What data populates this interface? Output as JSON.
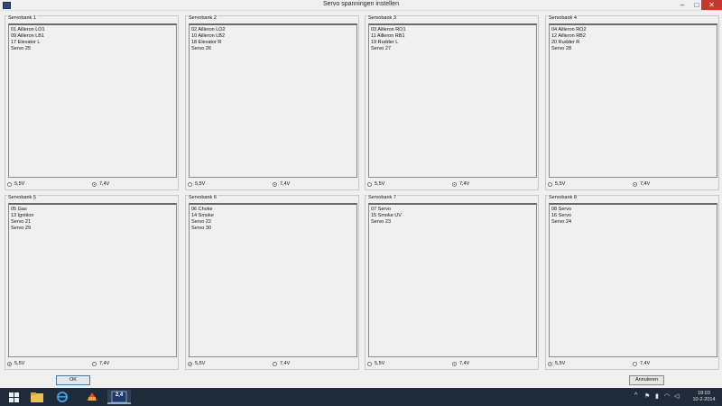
{
  "window": {
    "title": "Servo spanningen instellen",
    "minimize": "–",
    "maximize": "□",
    "close": "✕"
  },
  "banks": [
    {
      "caption": "Servobank 1",
      "items": [
        "01 Ailleron LO1",
        "09 Ailleron LB1",
        "17 Elevator L",
        "Servo 25"
      ],
      "low": "5,5V",
      "high": "7,4V",
      "selected": "7,4V"
    },
    {
      "caption": "Servobank 2",
      "items": [
        "02 Ailleron LO2",
        "10 Ailleron LB2",
        "18 Elevator R",
        "Servo 26"
      ],
      "low": "5,5V",
      "high": "7,4V",
      "selected": "7,4V"
    },
    {
      "caption": "Servobank 3",
      "items": [
        "03 Ailleron RO1",
        "11 Ailleron RB1",
        "19 Rudder L",
        "Servo 27"
      ],
      "low": "5,5V",
      "high": "7,4V",
      "selected": "7,4V"
    },
    {
      "caption": "Servobank 4",
      "items": [
        "04 Ailleron RO2",
        "12 Ailleron RB2",
        "20 Rudder R",
        "Servo 28"
      ],
      "low": "5,5V",
      "high": "7,4V",
      "selected": "7,4V"
    },
    {
      "caption": "Servobank 5",
      "items": [
        "05 Gas",
        "13 Ignition",
        "Servo 21",
        "Servo 29"
      ],
      "low": "5,5V",
      "high": "7,4V",
      "selected": "5,5V"
    },
    {
      "caption": "Servobank 6",
      "items": [
        "06 Choke",
        "14 Smoke",
        "Servo 22",
        "Servo 30"
      ],
      "low": "5,5V",
      "high": "7,4V",
      "selected": "5,5V"
    },
    {
      "caption": "Servobank 7",
      "items": [
        "07 Servo",
        "15 Smoke UV",
        "Servo 23"
      ],
      "low": "5,5V",
      "high": "7,4V",
      "selected": "7,4V"
    },
    {
      "caption": "Servobank 8",
      "items": [
        "08 Servo",
        "16 Servo",
        "Servo 24"
      ],
      "low": "5,5V",
      "high": "7,4V",
      "selected": "5,5V"
    }
  ],
  "buttons": {
    "ok": "OK",
    "cancel": "Annuleren"
  },
  "taskbar": {
    "icons": [
      "windows-start-icon",
      "file-explorer-icon",
      "internet-explorer-icon",
      "app-icon",
      "servo-app-icon"
    ],
    "app3_label": "2,4",
    "tray": {
      "up": "^",
      "flag": "⚑",
      "signal": "▮",
      "wifi": "◠",
      "volume": "◁"
    },
    "time": "18:03",
    "date": "10-2-2014"
  },
  "colors": {
    "close_button": "#c7372f",
    "taskbar": "#1f2a3a",
    "ok_border": "#3c7fb1"
  }
}
